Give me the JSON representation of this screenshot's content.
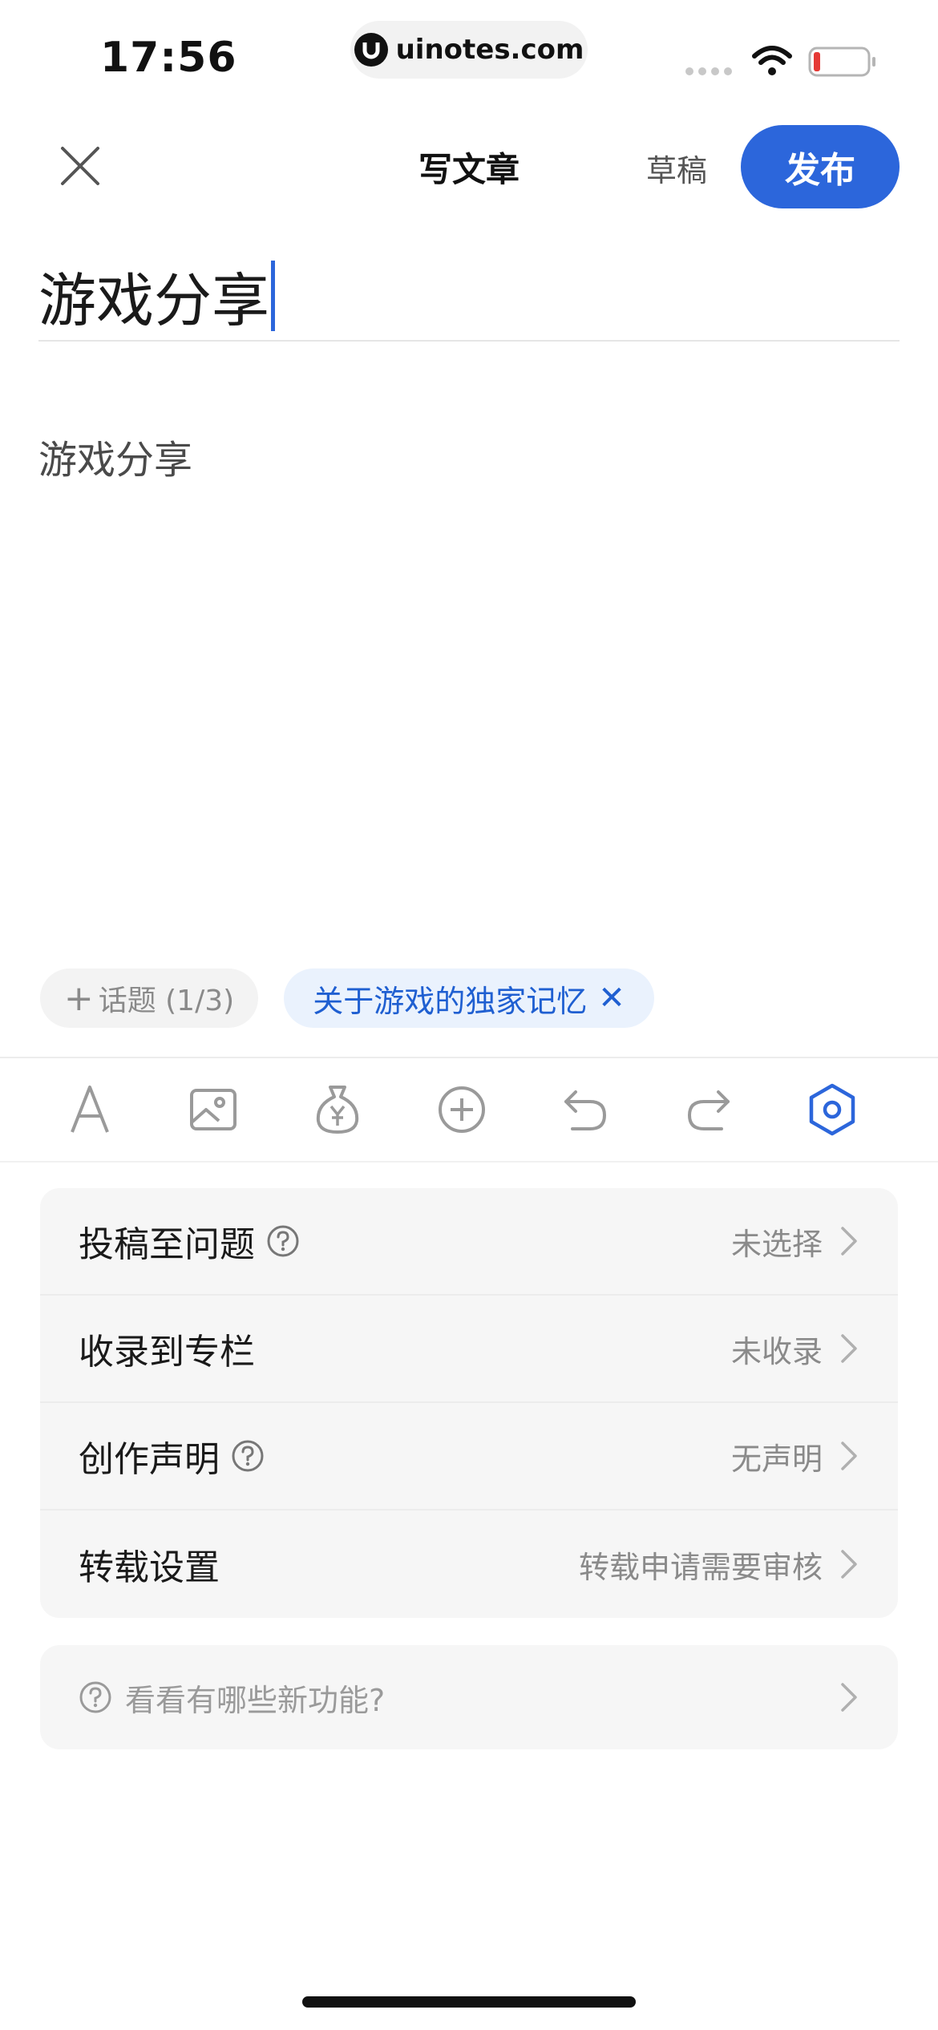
{
  "status_bar": {
    "time": "17:56",
    "url": "uinotes.com",
    "icons": [
      "signal-dots-icon",
      "wifi-icon",
      "battery-low-icon"
    ]
  },
  "header": {
    "title": "写文章",
    "draft_label": "草稿",
    "publish_label": "发布",
    "close_icon": "close-icon"
  },
  "editor": {
    "title_value": "游戏分享",
    "body_text": "游戏分享"
  },
  "topics": {
    "add_plus": "+",
    "add_label": "话题 (1/3)",
    "selected": "关于游戏的独家记忆",
    "remove_glyph": "✕"
  },
  "toolbar": {
    "items": [
      "text-format-icon",
      "image-icon",
      "money-bag-icon",
      "plus-circle-icon",
      "undo-icon",
      "redo-icon",
      "settings-hex-icon"
    ]
  },
  "settings": {
    "rows": [
      {
        "label": "投稿至问题",
        "value": "未选择",
        "help": true
      },
      {
        "label": "收录到专栏",
        "value": "未收录",
        "help": false
      },
      {
        "label": "创作声明",
        "value": "无声明",
        "help": true
      },
      {
        "label": "转载设置",
        "value": "转载申请需要审核",
        "help": false
      }
    ]
  },
  "whats_new": {
    "label": "看看有哪些新功能?"
  },
  "colors": {
    "accent": "#2c66db",
    "chip_bg": "#eaf2fd",
    "card_bg": "#f6f6f6",
    "battery_low": "#e53935"
  }
}
